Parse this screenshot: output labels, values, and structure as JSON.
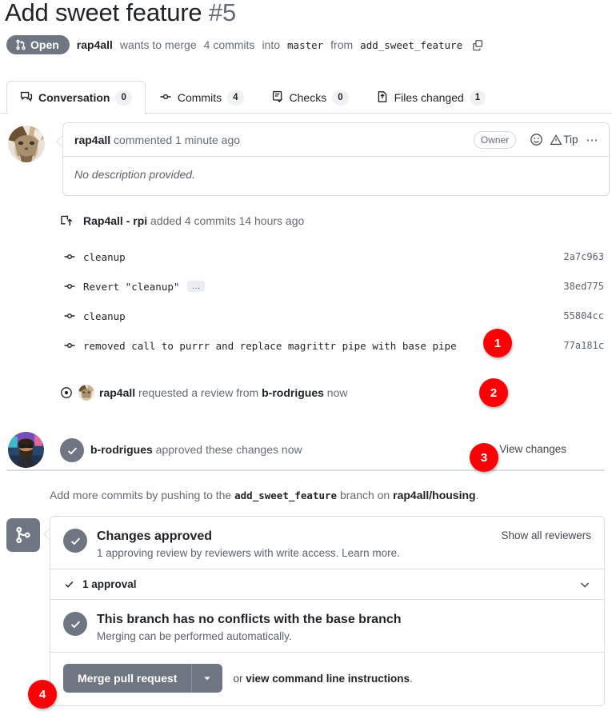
{
  "pr": {
    "title": "Add sweet feature",
    "number": "#5",
    "state_label": "Open",
    "state_color": "#6e7781",
    "author": "rap4all",
    "merge_sentence_1": "wants to merge",
    "commit_count_text": "4 commits",
    "merge_sentence_2": "into",
    "base_branch": "master",
    "merge_sentence_3": "from",
    "head_branch": "add_sweet_feature",
    "copy_icon": "copy-icon",
    "state_icon": "pull-request-icon"
  },
  "tabs": [
    {
      "label": "Conversation",
      "count": "0",
      "icon": "comment-discussion-icon",
      "active": true
    },
    {
      "label": "Commits",
      "count": "4",
      "icon": "git-commit-icon",
      "active": false
    },
    {
      "label": "Checks",
      "count": "0",
      "icon": "checklist-icon",
      "active": false
    },
    {
      "label": "Files changed",
      "count": "1",
      "icon": "file-diff-icon",
      "active": false
    }
  ],
  "comment": {
    "author": "rap4all",
    "action": "commented",
    "time": "1 minute ago",
    "badge": "Owner",
    "reaction_icon": "smiley-icon",
    "tip_icon": "alert-triangle-icon",
    "tip_label": "Tip",
    "menu_icon": "kebab-horizontal-icon",
    "body": "No description provided."
  },
  "timeline": {
    "commits_header": {
      "icon": "repo-push-icon",
      "actor": "Rap4all - rpi",
      "text": "added 4 commits",
      "time": "14 hours ago"
    },
    "commits": [
      {
        "message": "cleanup",
        "sha": "2a7c963",
        "has_more": false
      },
      {
        "message": "Revert \"cleanup\"",
        "sha": "38ed775",
        "has_more": true,
        "more_label": "…"
      },
      {
        "message": "cleanup",
        "sha": "55804cc",
        "has_more": false
      },
      {
        "message": "removed call to purrr and replace magrittr pipe with base pipe",
        "sha": "77a181c",
        "has_more": false
      }
    ],
    "review_request": {
      "icon": "eye-icon",
      "actor": "rap4all",
      "text_before": "requested a review from",
      "reviewer": "b-rodrigues",
      "time": "now"
    },
    "approval": {
      "icon": "check-icon",
      "actor": "b-rodrigues",
      "text": "approved these changes",
      "time": "now",
      "link": "View changes"
    }
  },
  "add_more": {
    "text_before": "Add more commits by pushing to the",
    "branch": "add_sweet_feature",
    "text_middle": "branch on",
    "repo": "rap4all/housing",
    "text_after": "."
  },
  "merge_panel": {
    "icon": "git-merge-icon",
    "approved": {
      "title": "Changes approved",
      "subtitle": "1 approving review by reviewers with write access. Learn more.",
      "right_link": "Show all reviewers"
    },
    "approval_row": {
      "label": "1 approval",
      "check_icon": "check-icon",
      "chevron_icon": "chevron-down-icon"
    },
    "conflicts": {
      "title": "This branch has no conflicts with the base branch",
      "subtitle": "Merging can be performed automatically."
    },
    "merge_button": {
      "label": "Merge pull request",
      "caret_icon": "triangle-down-icon",
      "color": "#6e7781"
    },
    "cli_text_before": "or",
    "cli_link": "view command line instructions",
    "cli_text_after": "."
  },
  "markers": [
    {
      "number": "1",
      "color": "#fb0007"
    },
    {
      "number": "2",
      "color": "#fb0007"
    },
    {
      "number": "3",
      "color": "#fb0007"
    },
    {
      "number": "4",
      "color": "#fb0007"
    }
  ]
}
